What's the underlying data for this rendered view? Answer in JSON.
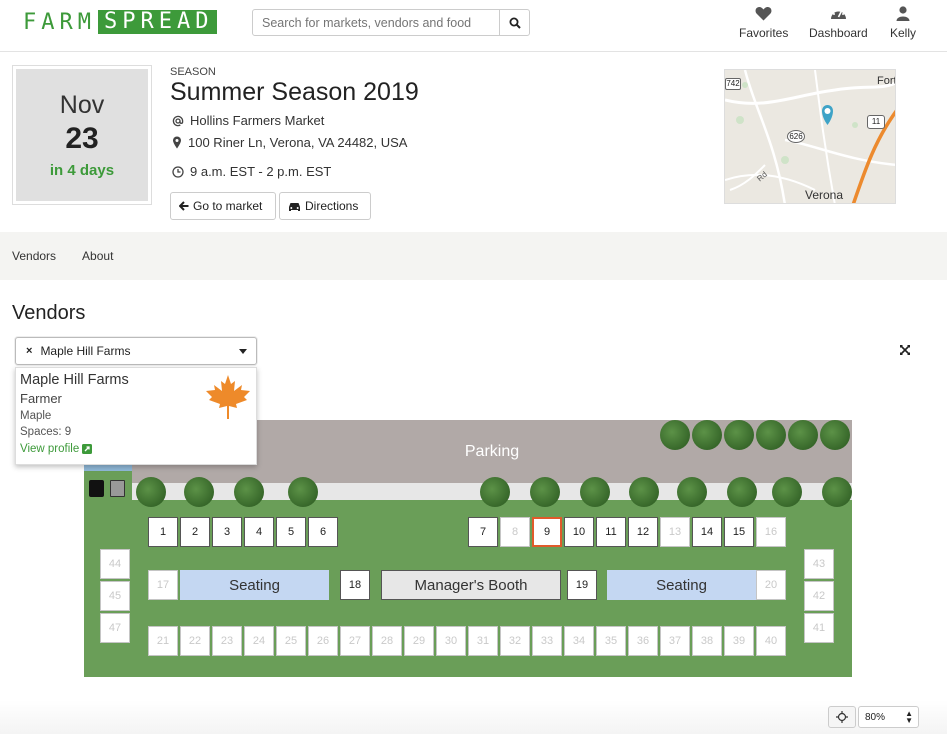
{
  "header": {
    "logo_left": "FARM",
    "logo_right": "SPREAD",
    "search_placeholder": "Search for markets, vendors and food",
    "nav": [
      {
        "label": "Favorites",
        "icon": "heart-icon"
      },
      {
        "label": "Dashboard",
        "icon": "dashboard-icon"
      },
      {
        "label": "Kelly",
        "icon": "user-icon"
      }
    ]
  },
  "event": {
    "month": "Nov",
    "day": "23",
    "relative": "in 4 days",
    "season_label": "SEASON",
    "title": "Summer Season 2019",
    "market": "Hollins Farmers Market",
    "address": "100 Riner Ln, Verona, VA 24482, USA",
    "hours": "9 a.m. EST - 2 p.m. EST",
    "go_button": "Go to market",
    "directions_button": "Directions"
  },
  "map": {
    "label_town": "Verona",
    "label_other": "Fort Defia",
    "route1": "742",
    "route2": "626",
    "route3": "11",
    "road": "Rd"
  },
  "tabs": [
    "Vendors",
    "About"
  ],
  "vendors": {
    "heading": "Vendors",
    "selected": "Maple Hill Farms",
    "card": {
      "name": "Maple Hill Farms",
      "type": "Farmer",
      "product": "Maple",
      "spaces": "Spaces: 9",
      "link": "View profile"
    }
  },
  "layout_map": {
    "parking": "Parking",
    "seating_left": "Seating",
    "seating_right": "Seating",
    "manager": "Manager's Booth",
    "top_left": [
      "1",
      "2",
      "3",
      "4",
      "5",
      "6"
    ],
    "top_right": [
      "7",
      "8",
      "9",
      "10",
      "11",
      "12",
      "13",
      "14",
      "15",
      "16"
    ],
    "dim_top": [
      "8",
      "13",
      "16"
    ],
    "selected_space": "9",
    "mid_row": [
      "17",
      "18",
      "19",
      "20"
    ],
    "dim_mid": [
      "17",
      "20"
    ],
    "bottom": [
      "21",
      "22",
      "23",
      "24",
      "25",
      "26",
      "27",
      "28",
      "29",
      "30",
      "31",
      "32",
      "33",
      "34",
      "35",
      "36",
      "37",
      "38",
      "39",
      "40"
    ],
    "left_col": [
      "44",
      "45",
      "47"
    ],
    "right_col": [
      "43",
      "42",
      "41"
    ]
  },
  "zoom": {
    "value": "80%"
  },
  "colors": {
    "brand_green": "#3d9a3a",
    "field": "#6a9e58",
    "selected_outline": "#e05a2b",
    "seating": "#c4d7f2"
  }
}
